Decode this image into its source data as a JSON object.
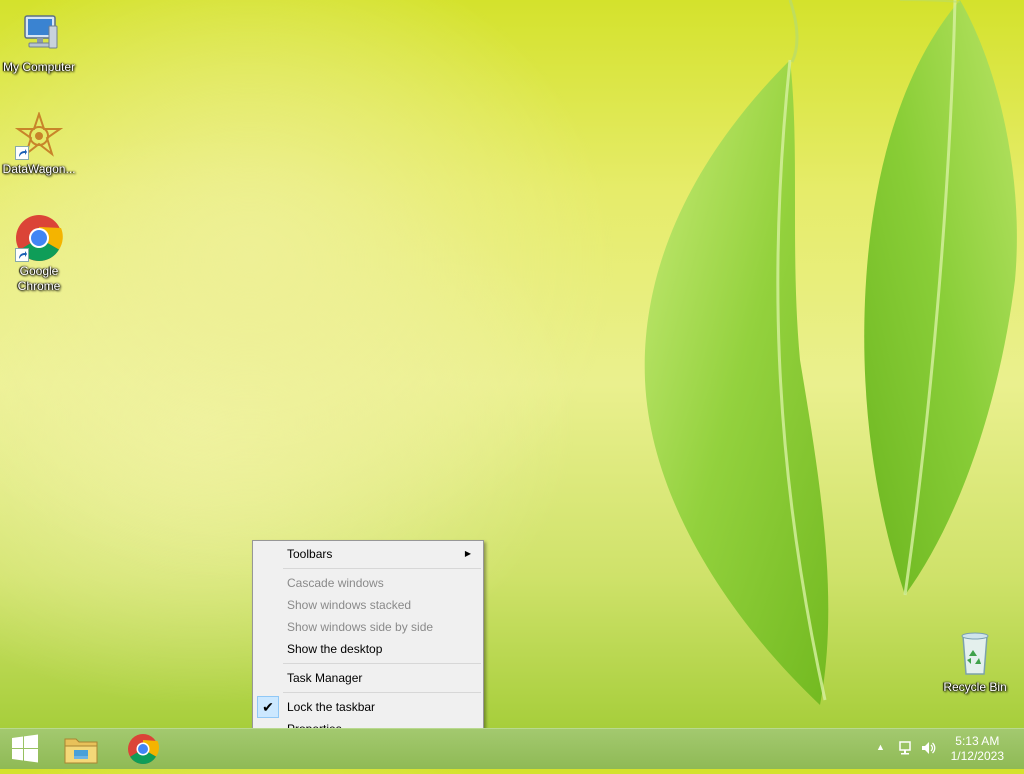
{
  "desktop": {
    "icons": [
      {
        "label": "My Computer"
      },
      {
        "label": "DataWagon..."
      },
      {
        "label_line1": "Google",
        "label_line2": "Chrome"
      },
      {
        "label": "Recycle Bin"
      }
    ]
  },
  "context_menu": {
    "items": [
      {
        "label": "Toolbars",
        "enabled": true,
        "submenu": true
      },
      {
        "label": "Cascade windows",
        "enabled": false
      },
      {
        "label": "Show windows stacked",
        "enabled": false
      },
      {
        "label": "Show windows side by side",
        "enabled": false
      },
      {
        "label": "Show the desktop",
        "enabled": true
      },
      {
        "label": "Task Manager",
        "enabled": true
      },
      {
        "label": "Lock the taskbar",
        "enabled": true,
        "checked": true
      },
      {
        "label": "Properties",
        "enabled": true
      }
    ]
  },
  "taskbar": {
    "buttons": [
      {
        "icon": "windows-logo-icon"
      },
      {
        "icon": "file-explorer-icon"
      },
      {
        "icon": "chrome-icon"
      }
    ],
    "tray": {
      "icons": [
        "chevron-up-icon",
        "network-icon",
        "volume-icon"
      ],
      "time": "5:13 AM",
      "date": "1/12/2023"
    }
  },
  "colors": {
    "taskbar": "#8fba55",
    "menu_bg": "#f0f0f0",
    "menu_check_bg": "#cce8ff",
    "disabled_text": "#8a8a8a"
  }
}
